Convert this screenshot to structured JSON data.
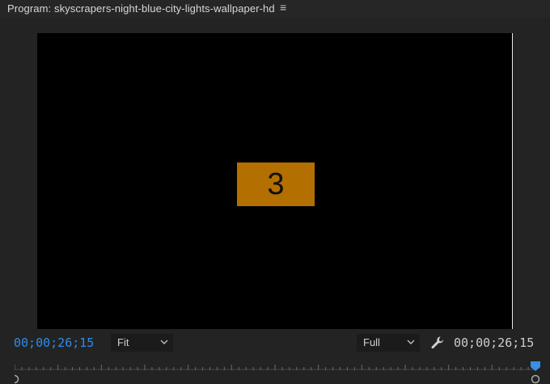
{
  "panel": {
    "title": "Program: skyscrapers-night-blue-city-lights-wallpaper-hd",
    "menu_icon": "hamburger-menu-icon"
  },
  "monitor": {
    "countdown_number": "3",
    "badge_color": "#b36f00"
  },
  "controls": {
    "current_timecode": "00;00;26;15",
    "zoom_select": "Fit",
    "resolution_select": "Full",
    "settings_icon": "wrench-icon",
    "duration_timecode": "00;00;26;15"
  },
  "colors": {
    "timecode_accent": "#2d8ceb",
    "playhead": "#3a8ee6",
    "background": "#232323",
    "video_background": "#000000"
  }
}
